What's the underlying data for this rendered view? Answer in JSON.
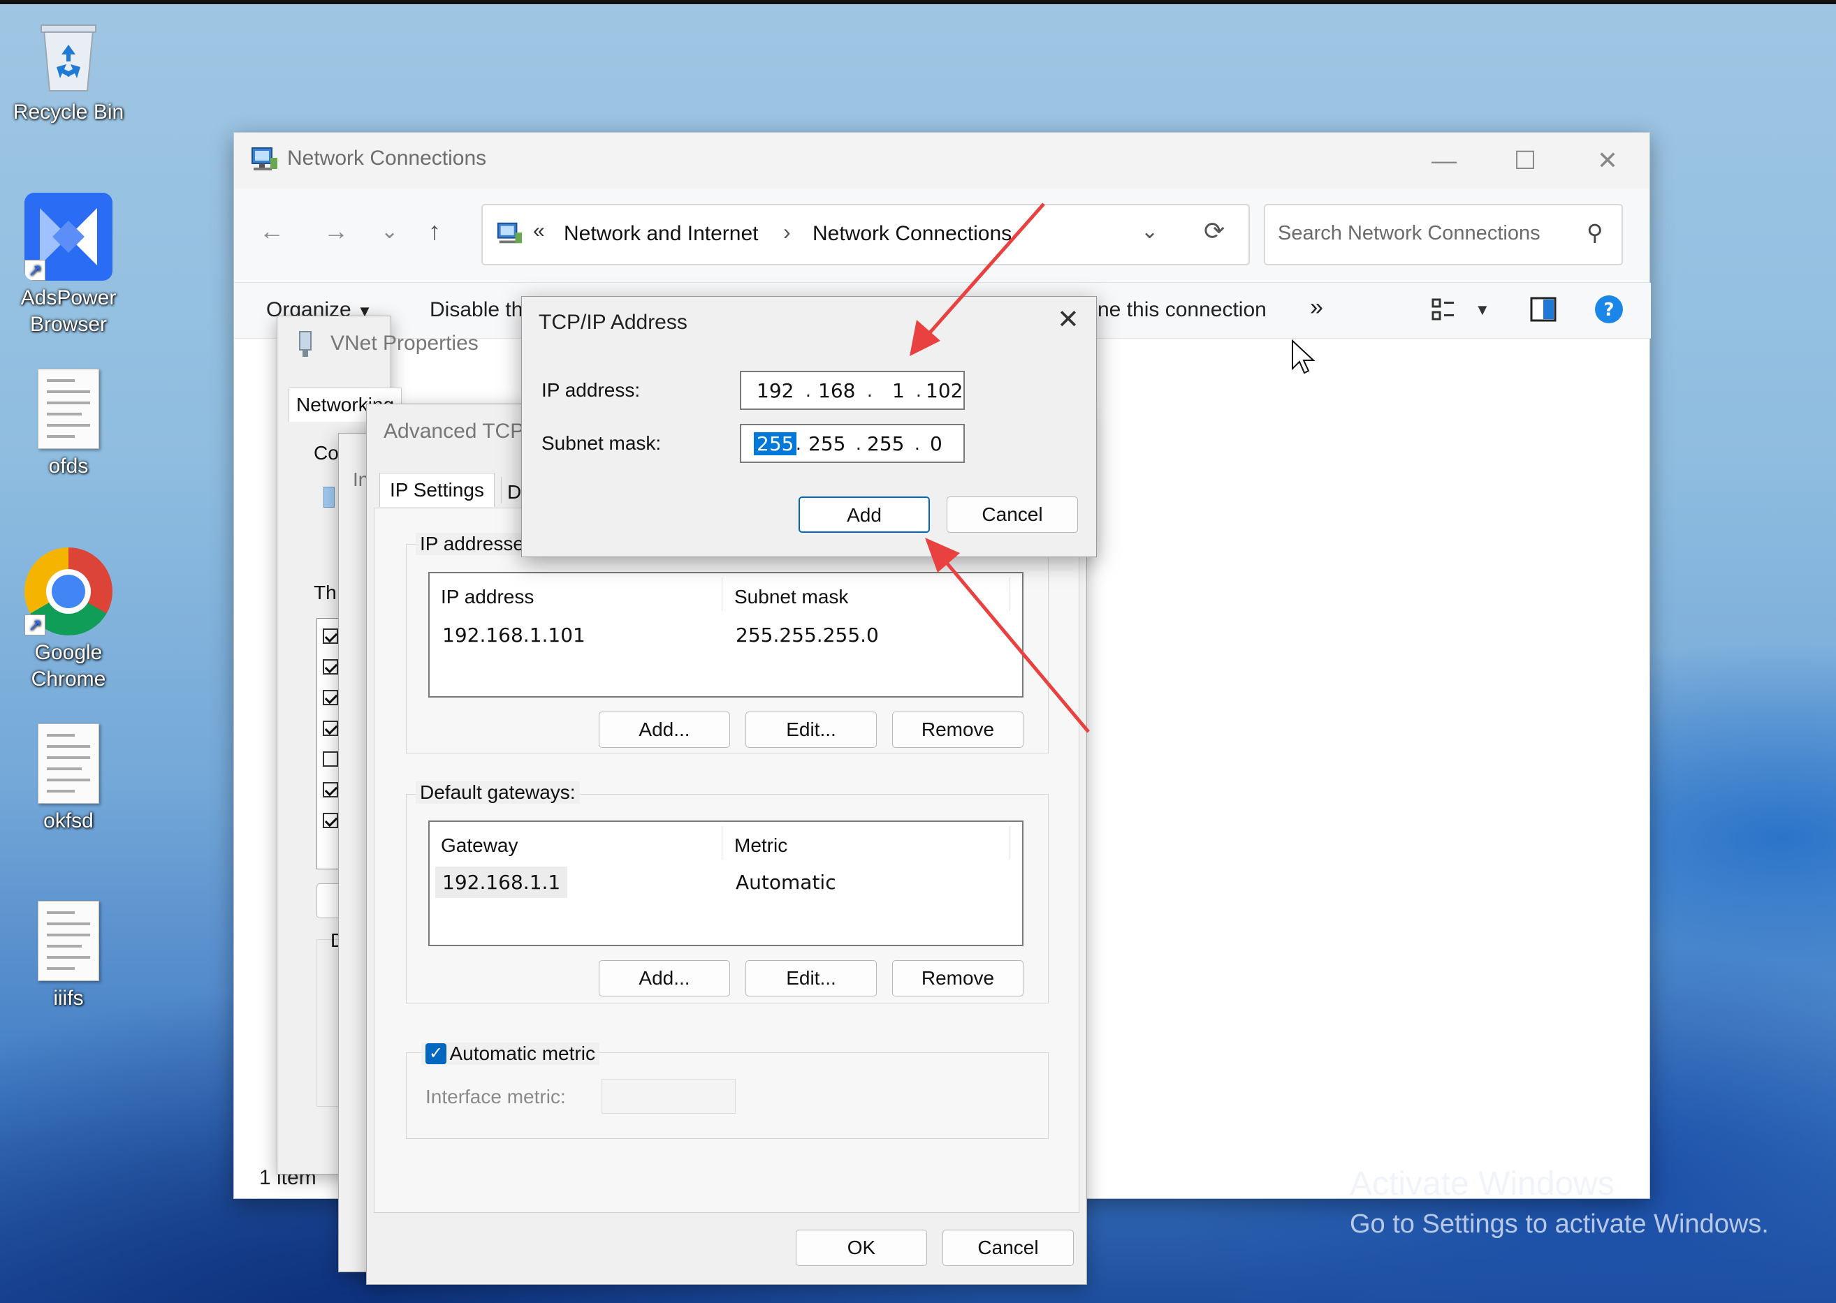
{
  "desktop": {
    "icons": [
      {
        "name": "recycle-bin",
        "label": "Recycle Bin"
      },
      {
        "name": "adspower",
        "label_line1": "AdsPower",
        "label_line2": "Browser"
      },
      {
        "name": "ofds",
        "label": "ofds"
      },
      {
        "name": "chrome",
        "label_line1": "Google",
        "label_line2": "Chrome"
      },
      {
        "name": "okfsd",
        "label": "okfsd"
      },
      {
        "name": "iiifs",
        "label": "iiifs"
      }
    ]
  },
  "explorer": {
    "title": "Network Connections",
    "breadcrumb_prefix": "«",
    "breadcrumb": [
      "Network and Internet",
      "Network Connections"
    ],
    "breadcrumb_sep": "›",
    "search_placeholder": "Search Network Connections",
    "cmd_organize": "Organize",
    "cmd_disable": "Disable th",
    "cmd_rename": "ne this connection",
    "cmd_more": "»",
    "status": "1 item"
  },
  "vnet": {
    "title": "VNet Properties",
    "tab": "Networking",
    "conn_label": "Conn",
    "this_label": "Th",
    "checkbox_states": [
      true,
      true,
      true,
      true,
      false,
      true,
      true
    ],
    "d_label": "D"
  },
  "ipv4": {
    "tab_fragment": "In"
  },
  "advanced": {
    "title": "Advanced TCP/",
    "tabs": [
      "IP Settings",
      "DI"
    ],
    "ip_group": "IP addresses",
    "ip_columns": [
      "IP address",
      "Subnet mask"
    ],
    "ip_rows": [
      {
        "ip": "192.168.1.101",
        "mask": "255.255.255.0"
      }
    ],
    "gw_group": "Default gateways:",
    "gw_columns": [
      "Gateway",
      "Metric"
    ],
    "gw_rows": [
      {
        "gateway": "192.168.1.1",
        "metric": "Automatic"
      }
    ],
    "btn_add": "Add...",
    "btn_edit": "Edit...",
    "btn_remove": "Remove",
    "auto_metric_label": "Automatic metric",
    "auto_metric_checked": true,
    "interface_metric_label": "Interface metric:",
    "ok": "OK",
    "cancel": "Cancel"
  },
  "tcpip": {
    "title": "TCP/IP Address",
    "ip_label": "IP address:",
    "ip_octets": [
      "192",
      "168",
      "1",
      "102"
    ],
    "mask_label": "Subnet mask:",
    "mask_octets": [
      "255",
      "255",
      "255",
      "0"
    ],
    "add": "Add",
    "cancel": "Cancel"
  },
  "watermark": {
    "line1": "Activate Windows",
    "line2": "Go to Settings to activate Windows."
  },
  "colors": {
    "accent": "#0067c0",
    "annotation_arrow": "#e8413f",
    "selection": "#0078d7"
  }
}
